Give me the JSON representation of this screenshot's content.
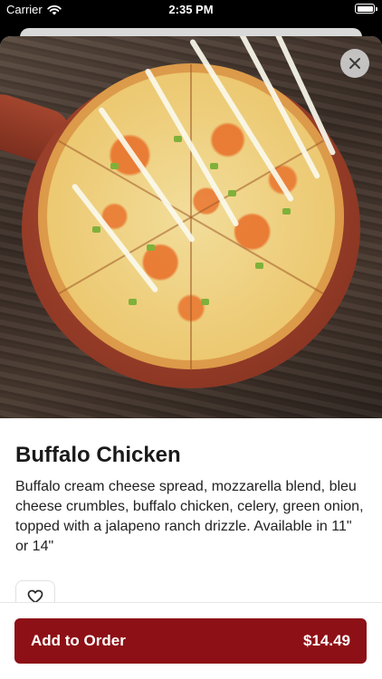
{
  "status_bar": {
    "carrier": "Carrier",
    "time": "2:35 PM"
  },
  "item": {
    "title": "Buffalo Chicken",
    "description": "Buffalo cream cheese spread, mozzarella blend, bleu cheese crumbles, buffalo chicken, celery, green onion, topped with a jalapeno ranch drizzle. Available in 11\" or 14\"",
    "image_alt": "Buffalo Chicken pizza"
  },
  "actions": {
    "add_label": "Add to Order",
    "price": "$14.49"
  },
  "icons": {
    "close": "close-icon",
    "favorite": "heart-icon",
    "wifi": "wifi-icon",
    "battery": "battery-icon"
  },
  "colors": {
    "accent": "#8d1016",
    "text": "#1a1a1a"
  }
}
